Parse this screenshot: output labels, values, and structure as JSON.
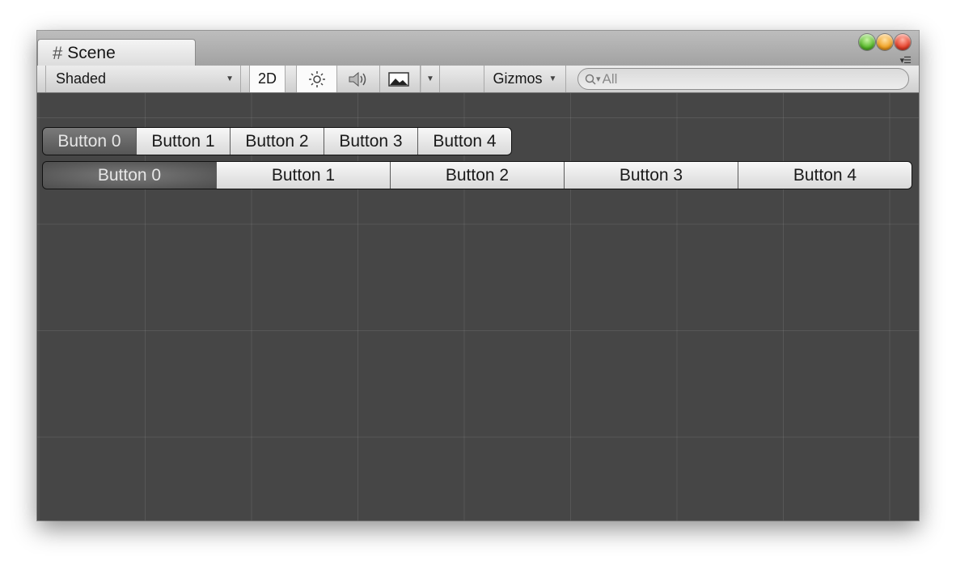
{
  "tab": {
    "icon": "grid-hash-icon",
    "title": "Scene"
  },
  "window_controls": [
    "minimize-green",
    "zoom-orange",
    "close-red"
  ],
  "toolbar": {
    "shading_mode": "Shaded",
    "mode_2d": "2D",
    "lighting_icon": "sun-icon",
    "audio_icon": "speaker-icon",
    "effects_icon": "image-icon",
    "gizmos_label": "Gizmos",
    "search_placeholder": "All"
  },
  "toolbar_rows": [
    {
      "buttons": [
        "Button 0",
        "Button 1",
        "Button 2",
        "Button 3",
        "Button 4"
      ],
      "selected_index": 0
    },
    {
      "buttons": [
        "Button 0",
        "Button 1",
        "Button 2",
        "Button 3",
        "Button 4"
      ],
      "selected_index": 0
    }
  ],
  "colors": {
    "scene_background": "#464646",
    "selected_button": "#5f5f5f",
    "toolbar": "#dcdcdc"
  }
}
